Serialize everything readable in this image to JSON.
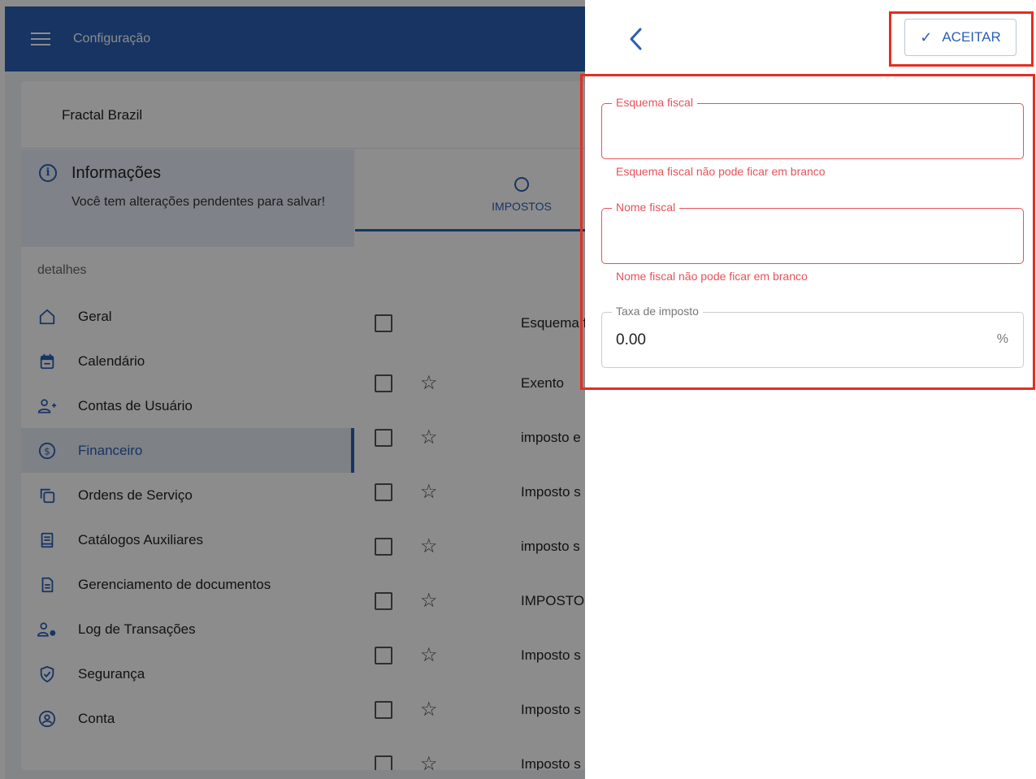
{
  "topbar": {
    "title": "Configuração"
  },
  "company": {
    "name": "Fractal Brazil"
  },
  "info": {
    "title": "Informações",
    "message": "Você tem alterações pendentes para salvar!"
  },
  "sidebar": {
    "section_label": "detalhes",
    "items": [
      {
        "label": "Geral",
        "icon": "home-icon"
      },
      {
        "label": "Calendário",
        "icon": "calendar-icon"
      },
      {
        "label": "Contas de Usuário",
        "icon": "user-add-icon"
      },
      {
        "label": "Financeiro",
        "icon": "dollar-icon",
        "active": true
      },
      {
        "label": "Ordens de Serviço",
        "icon": "copy-icon"
      },
      {
        "label": "Catálogos Auxiliares",
        "icon": "book-icon"
      },
      {
        "label": "Gerenciamento de documentos",
        "icon": "document-icon"
      },
      {
        "label": "Log de Transações",
        "icon": "user-log-icon"
      },
      {
        "label": "Segurança",
        "icon": "shield-icon"
      },
      {
        "label": "Conta",
        "icon": "account-icon"
      }
    ]
  },
  "tabs": [
    {
      "label": "IMPOSTOS",
      "icon": "tax-icon"
    }
  ],
  "list": {
    "header": "Esquema f",
    "rows": [
      "Exento",
      "imposto e",
      "Imposto s",
      "imposto s",
      "IMPOSTO",
      "Imposto s",
      "Imposto s",
      "Imposto s"
    ]
  },
  "panel": {
    "accept_label": "ACEITAR",
    "fields": [
      {
        "label": "Esquema fiscal",
        "value": "",
        "error": "Esquema fiscal não pode ficar em branco"
      },
      {
        "label": "Nome fiscal",
        "value": "",
        "error": "Nome fiscal não pode ficar em branco"
      },
      {
        "label": "Taxa de imposto",
        "value": "0.00",
        "suffix": "%"
      }
    ]
  },
  "colors": {
    "primary": "#2b5fb4",
    "error": "#e8515a",
    "highlight": "#e62d1f"
  }
}
